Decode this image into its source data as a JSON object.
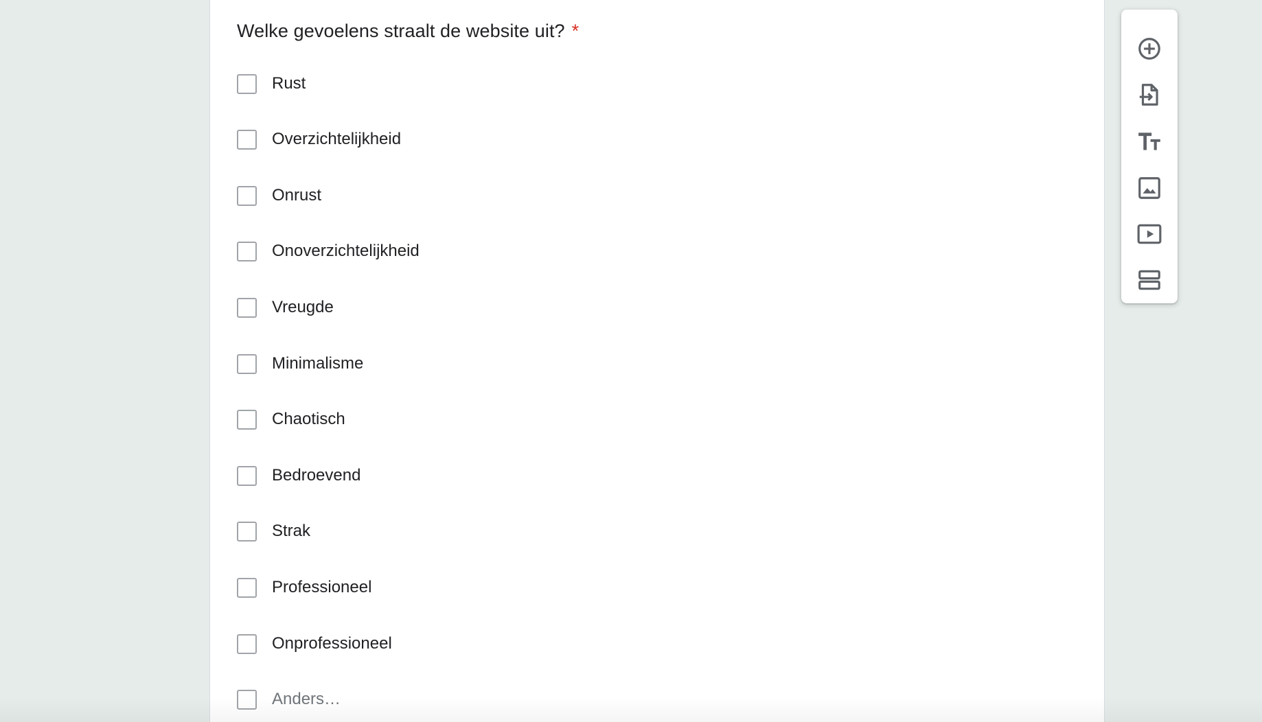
{
  "question": {
    "title": "Welke gevoelens straalt de website uit?",
    "required_marker": "*"
  },
  "options": [
    {
      "label": "Rust",
      "checked": false
    },
    {
      "label": "Overzichtelijkheid",
      "checked": false
    },
    {
      "label": "Onrust",
      "checked": false
    },
    {
      "label": "Onoverzichtelijkheid",
      "checked": false
    },
    {
      "label": "Vreugde",
      "checked": false
    },
    {
      "label": "Minimalisme",
      "checked": false
    },
    {
      "label": "Chaotisch",
      "checked": false
    },
    {
      "label": "Bedroevend",
      "checked": false
    },
    {
      "label": "Strak",
      "checked": false
    },
    {
      "label": "Professioneel",
      "checked": false
    },
    {
      "label": "Onprofessioneel",
      "checked": false
    },
    {
      "label": "Anders…",
      "checked": false
    }
  ],
  "toolbar": {
    "items": [
      {
        "icon": "add-circle-icon"
      },
      {
        "icon": "import-questions-icon"
      },
      {
        "icon": "title-text-icon"
      },
      {
        "icon": "image-icon"
      },
      {
        "icon": "video-icon"
      },
      {
        "icon": "section-icon"
      }
    ]
  },
  "colors": {
    "page_background": "#e6ecea",
    "required": "#d93025",
    "checkbox_border": "#a0a4a8",
    "icon": "#5f6368"
  }
}
